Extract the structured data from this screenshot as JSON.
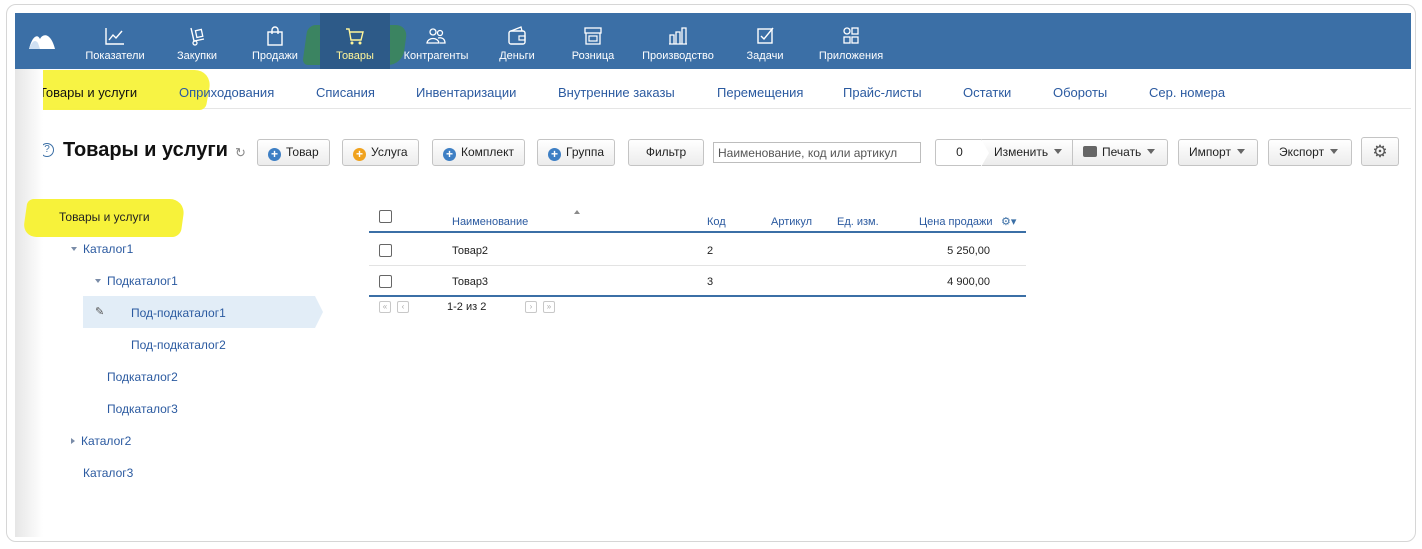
{
  "topnav": {
    "items": [
      {
        "label": "Показатели",
        "icon": "chart-line-icon"
      },
      {
        "label": "Закупки",
        "icon": "dolly-icon"
      },
      {
        "label": "Продажи",
        "icon": "shopping-bag-icon"
      },
      {
        "label": "Товары",
        "icon": "cart-icon",
        "active": true
      },
      {
        "label": "Контрагенты",
        "icon": "users-icon"
      },
      {
        "label": "Деньги",
        "icon": "wallet-icon"
      },
      {
        "label": "Розница",
        "icon": "store-icon"
      },
      {
        "label": "Производство",
        "icon": "factory-icon"
      },
      {
        "label": "Задачи",
        "icon": "checkbox-icon"
      },
      {
        "label": "Приложения",
        "icon": "apps-grid-icon"
      }
    ]
  },
  "subtabs": [
    {
      "label": "Товары и услуги",
      "active": true
    },
    {
      "label": "Оприходования"
    },
    {
      "label": "Списания"
    },
    {
      "label": "Инвентаризации"
    },
    {
      "label": "Внутренние заказы"
    },
    {
      "label": "Перемещения"
    },
    {
      "label": "Прайс-листы"
    },
    {
      "label": "Остатки"
    },
    {
      "label": "Обороты"
    },
    {
      "label": "Сер. номера"
    }
  ],
  "toolbar": {
    "help": "?",
    "title": "Товары и услуги",
    "refresh": "↻",
    "plus": "+",
    "buttons": {
      "item": "Товар",
      "service": "Услуга",
      "kit": "Комплект",
      "group": "Группа",
      "filter": "Фильтр",
      "change": "Изменить",
      "print": "Печать",
      "import": "Импорт",
      "export": "Экспорт"
    },
    "search_placeholder": "Наименование, код или артикул",
    "selected_count": "0",
    "settings_glyph": "⚙"
  },
  "tree": {
    "root": "Товары и услуги",
    "nodes": {
      "catalog1": "Каталог1",
      "subcatalog1": "Подкаталог1",
      "subsub1": "Под-подкаталог1",
      "subsub2": "Под-подкаталог2",
      "subcatalog2": "Подкаталог2",
      "subcatalog3": "Подкаталог3",
      "catalog2": "Каталог2",
      "catalog3": "Каталог3"
    },
    "selected": "Под-подкаталог1",
    "edit_glyph": "✎"
  },
  "table": {
    "columns": {
      "name": "Наименование",
      "code": "Код",
      "article": "Артикул",
      "unit": "Ед. изм.",
      "price": "Цена продажи"
    },
    "column_settings_glyph": "⚙▾",
    "rows": [
      {
        "name": "Товар2",
        "code": "2",
        "article": "",
        "unit": "",
        "price": "5 250,00"
      },
      {
        "name": "Товар3",
        "code": "3",
        "article": "",
        "unit": "",
        "price": "4 900,00"
      }
    ],
    "pager": {
      "summary": "1-2 из 2",
      "first": "«",
      "prev": "‹",
      "next": "›",
      "last": "»"
    }
  },
  "colors": {
    "nav_bg": "#3b6fa6",
    "link": "#2b5aa0",
    "highlight_yellow": "#f7f23a",
    "highlight_green": "#3c9628"
  }
}
